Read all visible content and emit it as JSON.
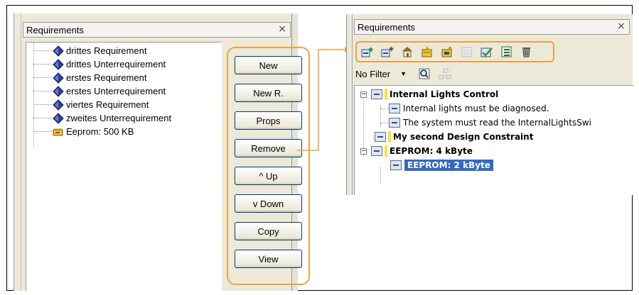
{
  "left_panel": {
    "title": "Requirements",
    "close_glyph": "×",
    "tree_items": [
      {
        "label": "drittes Requirement",
        "icon": "requirement-icon"
      },
      {
        "label": "drittes Unterrequirement",
        "icon": "requirement-icon"
      },
      {
        "label": "erstes Requirement",
        "icon": "requirement-icon"
      },
      {
        "label": "erstes Unterrequirement",
        "icon": "requirement-icon"
      },
      {
        "label": "viertes Requirement",
        "icon": "requirement-icon"
      },
      {
        "label": "zweites Unterrequirement",
        "icon": "requirement-icon"
      },
      {
        "label": "Eeprom: 500 KB",
        "icon": "eeprom-icon"
      }
    ],
    "buttons": {
      "new": "New",
      "new_r": "New R.",
      "props": "Props",
      "remove": "Remove",
      "up": "^ Up",
      "down": "v Down",
      "copy": "Copy",
      "view": "View"
    }
  },
  "right_panel": {
    "title": "Requirements",
    "close_glyph": "×",
    "filter": {
      "value": "No Filter"
    },
    "toolbar_icons": [
      "new-requirement-icon",
      "new-subrequirement-icon",
      "properties-icon",
      "new-resource-icon",
      "new-subresource-icon",
      "disabled-icon",
      "check-icon",
      "list-icon",
      "delete-icon"
    ],
    "tree": {
      "n1": "Internal Lights Control",
      "n1a": "Internal lights must be diagnosed.",
      "n1b": "The system must read the InternalLightsSwi",
      "n2": "My second Design Constraint",
      "n3": "EEPROM: 4 kByte",
      "n3a": "EEPROM: 2 kByte"
    }
  },
  "colors": {
    "highlight": "#f2a03a",
    "selection": "#316ac5",
    "panel": "#ece9d8"
  }
}
